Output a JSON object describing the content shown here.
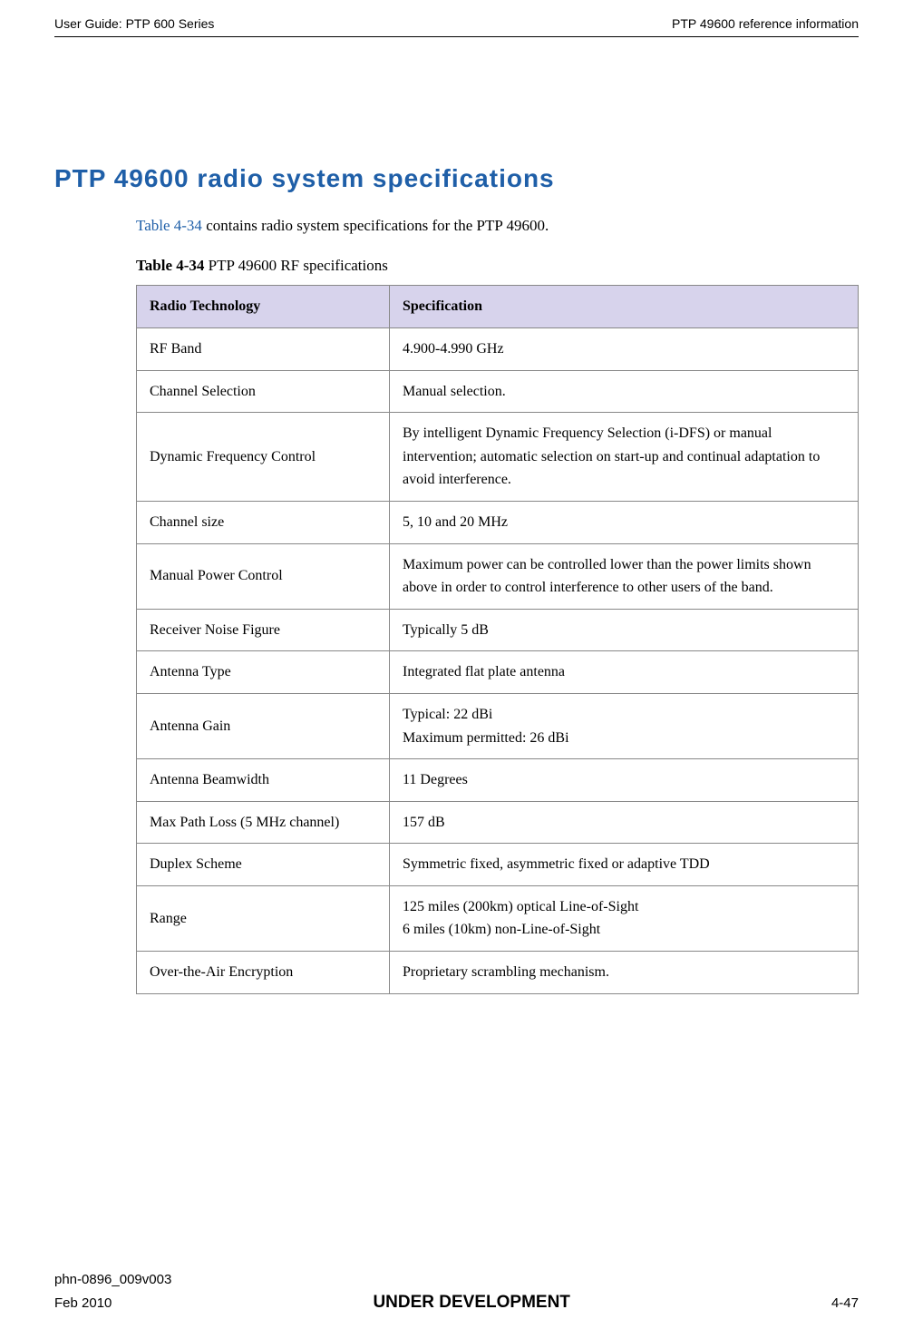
{
  "header": {
    "left": "User Guide: PTP 600 Series",
    "right": "PTP 49600 reference information"
  },
  "section": {
    "title": "PTP 49600 radio system specifications",
    "intro_pre": "",
    "intro_link": "Table 4-34",
    "intro_post": " contains radio system specifications for the PTP 49600.",
    "table_label": "Table 4-34",
    "table_caption": "  PTP 49600 RF specifications"
  },
  "table": {
    "head_col1": "Radio Technology",
    "head_col2": "Specification",
    "rows": [
      {
        "c1": "RF Band",
        "c2": "4.900-4.990 GHz"
      },
      {
        "c1": "Channel Selection",
        "c2": "Manual selection."
      },
      {
        "c1": "Dynamic Frequency Control",
        "c2": "By intelligent Dynamic Frequency Selection (i-DFS) or manual intervention; automatic selection on start-up and continual adaptation to avoid interference."
      },
      {
        "c1": "Channel size",
        "c2": "5, 10 and 20 MHz"
      },
      {
        "c1": "Manual Power Control",
        "c2": "Maximum power can be controlled lower than the power limits shown above in order to control interference to other users of the band."
      },
      {
        "c1": "Receiver Noise Figure",
        "c2": "Typically 5 dB"
      },
      {
        "c1": "Antenna Type",
        "c2": "Integrated flat plate antenna"
      },
      {
        "c1": "Antenna Gain",
        "c2": "Typical: 22 dBi\nMaximum permitted: 26 dBi"
      },
      {
        "c1": "Antenna Beamwidth",
        "c2": "11 Degrees"
      },
      {
        "c1": "Max Path Loss (5 MHz channel)",
        "c2": "157 dB"
      },
      {
        "c1": "Duplex Scheme",
        "c2": "Symmetric fixed, asymmetric fixed or adaptive TDD"
      },
      {
        "c1": "Range",
        "c2": "125 miles (200km) optical Line-of-Sight\n6 miles (10km) non-Line-of-Sight"
      },
      {
        "c1": "Over-the-Air Encryption",
        "c2": "Proprietary scrambling mechanism."
      }
    ]
  },
  "footer": {
    "doc_id": "phn-0896_009v003",
    "date": "Feb 2010",
    "status": "UNDER DEVELOPMENT",
    "page": "4-47"
  }
}
